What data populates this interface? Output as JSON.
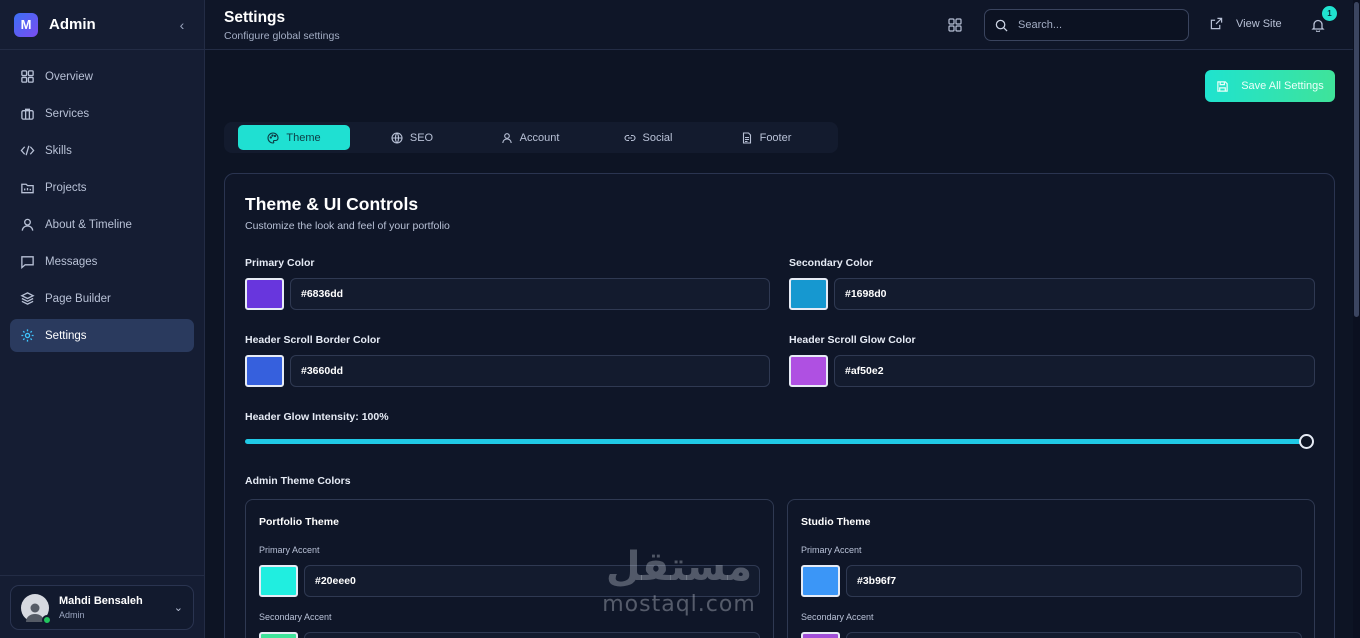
{
  "app": {
    "brand_letter": "M",
    "brand_title": "Admin",
    "collapse_icon": "chevron-left-icon"
  },
  "sidebar": {
    "items": [
      {
        "label": "Overview",
        "icon": "grid-icon"
      },
      {
        "label": "Services",
        "icon": "briefcase-icon"
      },
      {
        "label": "Skills",
        "icon": "code-icon"
      },
      {
        "label": "Projects",
        "icon": "folder-icon"
      },
      {
        "label": "About & Timeline",
        "icon": "user-icon"
      },
      {
        "label": "Messages",
        "icon": "message-icon"
      },
      {
        "label": "Page Builder",
        "icon": "layers-icon"
      },
      {
        "label": "Settings",
        "icon": "gear-icon",
        "active": true
      }
    ],
    "user": {
      "name": "Mahdi Bensaleh",
      "role": "Admin",
      "status": "online"
    }
  },
  "header": {
    "title": "Settings",
    "subtitle": "Configure global settings",
    "search_placeholder": "Search...",
    "view_site_label": "View Site",
    "notification_count": "1"
  },
  "toolbar": {
    "save_label": "Save All Settings"
  },
  "tabs": [
    {
      "label": "Theme",
      "icon": "palette-icon",
      "active": true
    },
    {
      "label": "SEO",
      "icon": "globe-icon"
    },
    {
      "label": "Account",
      "icon": "user-icon"
    },
    {
      "label": "Social",
      "icon": "link-icon"
    },
    {
      "label": "Footer",
      "icon": "file-icon"
    }
  ],
  "theme_panel": {
    "title": "Theme & UI Controls",
    "subtitle": "Customize the look and feel of your portfolio",
    "primary_color": {
      "label": "Primary Color",
      "value": "#6836dd"
    },
    "secondary_color": {
      "label": "Secondary Color",
      "value": "#1698d0"
    },
    "header_border_color": {
      "label": "Header Scroll Border Color",
      "value": "#3660dd"
    },
    "header_glow_color": {
      "label": "Header Scroll Glow Color",
      "value": "#af50e2"
    },
    "glow_intensity": {
      "label": "Header Glow Intensity: 100%",
      "value": 100
    },
    "admin_theme_label": "Admin Theme Colors",
    "portfolio_theme": {
      "title": "Portfolio Theme",
      "primary_label": "Primary Accent",
      "primary_value": "#20eee0",
      "secondary_label": "Secondary Accent",
      "secondary_swatch": "#3fe39a"
    },
    "studio_theme": {
      "title": "Studio Theme",
      "primary_label": "Primary Accent",
      "primary_value": "#3b96f7",
      "secondary_label": "Secondary Accent",
      "secondary_swatch": "#a14fd8"
    }
  },
  "watermark": {
    "arabic": "مستقل",
    "latin": "mostaql.com"
  }
}
